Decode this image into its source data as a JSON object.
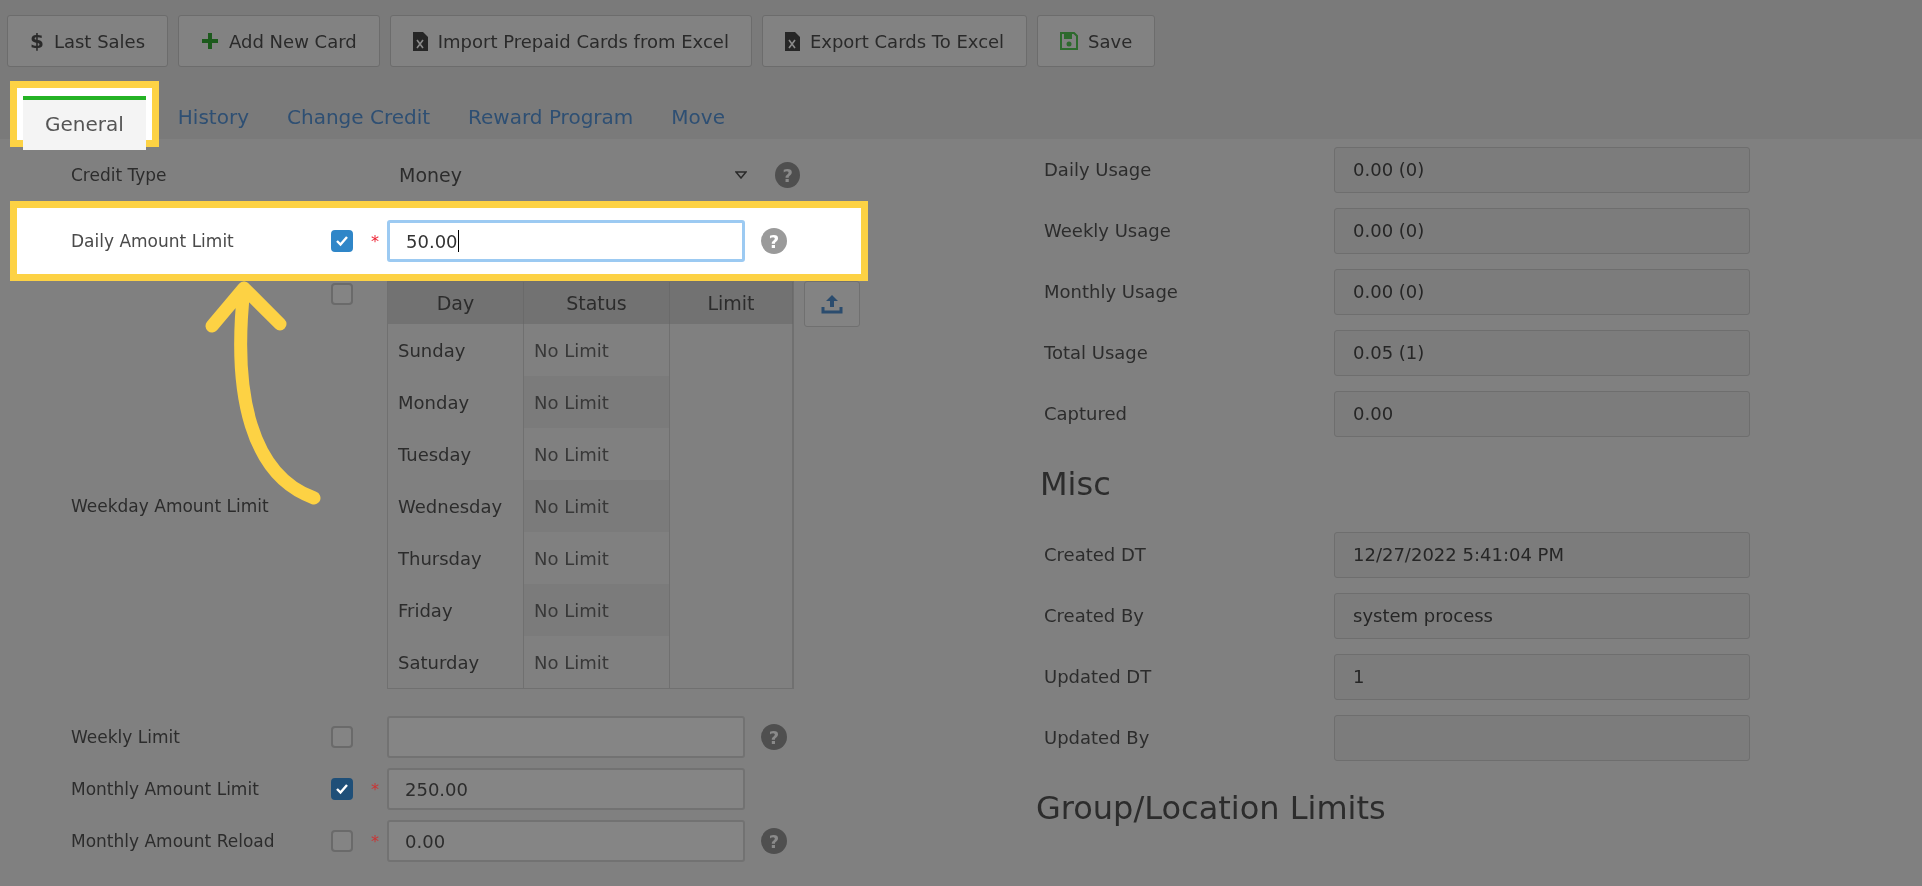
{
  "toolbar": [
    {
      "kind": "dollar",
      "icon": "$",
      "label": "Last Sales"
    },
    {
      "kind": "plus",
      "label": "Add New Card"
    },
    {
      "kind": "excel",
      "label": "Import Prepaid Cards from Excel"
    },
    {
      "kind": "excel",
      "label": "Export Cards To Excel"
    },
    {
      "kind": "save",
      "label": "Save"
    }
  ],
  "tabs": [
    {
      "label": "General",
      "selected": true,
      "highlighted": true
    },
    {
      "label": "History",
      "selected": false,
      "highlighted": false
    },
    {
      "label": "Change Credit",
      "selected": false,
      "highlighted": false
    },
    {
      "label": "Reward Program",
      "selected": false,
      "highlighted": false
    },
    {
      "label": "Move",
      "selected": false,
      "highlighted": false
    }
  ],
  "left_fields": [
    {
      "kind": "select",
      "label": "Credit Type",
      "value": "Money",
      "help": "?"
    },
    {
      "kind": "limit",
      "label": "Daily Amount Limit",
      "checked": true,
      "required": "*",
      "value": "50.00",
      "help": "?",
      "highlighted": true
    },
    {
      "kind": "weekday",
      "label": "Weekday Amount Limit",
      "checked": false,
      "columns": [
        "Day",
        "Status",
        "Limit"
      ],
      "rows": [
        {
          "day": "Sunday",
          "status": "No Limit"
        },
        {
          "day": "Monday",
          "status": "No Limit"
        },
        {
          "day": "Tuesday",
          "status": "No Limit"
        },
        {
          "day": "Wednesday",
          "status": "No Limit"
        },
        {
          "day": "Thursday",
          "status": "No Limit"
        },
        {
          "day": "Friday",
          "status": "No Limit"
        },
        {
          "day": "Saturday",
          "status": "No Limit"
        }
      ]
    },
    {
      "kind": "limit",
      "label": "Weekly Limit",
      "checked": false,
      "help": "?",
      "highlighted": false
    },
    {
      "kind": "limit",
      "label": "Monthly Amount Limit",
      "checked": true,
      "required": "*",
      "value": "250.00",
      "highlighted": false
    },
    {
      "kind": "limit",
      "label": "Monthly Amount Reload",
      "checked": false,
      "required": "*",
      "value": "0.00",
      "help": "?",
      "highlighted": false
    }
  ],
  "usage": [
    {
      "label": "Daily Usage",
      "value": "0.00 (0)"
    },
    {
      "label": "Weekly Usage",
      "value": "0.00 (0)"
    },
    {
      "label": "Monthly Usage",
      "value": "0.00 (0)"
    },
    {
      "label": "Total Usage",
      "value": "0.05 (1)"
    },
    {
      "label": "Captured",
      "value": "0.00"
    }
  ],
  "misc": {
    "title": "Misc",
    "rows": [
      {
        "label": "Created DT",
        "value": "12/27/2022 5:41:04 PM"
      },
      {
        "label": "Created By",
        "value": "system process"
      },
      {
        "label": "Updated DT",
        "value": "1"
      },
      {
        "label": "Updated By"
      }
    ]
  },
  "group_limits": {
    "title": "Group/Location Limits"
  }
}
